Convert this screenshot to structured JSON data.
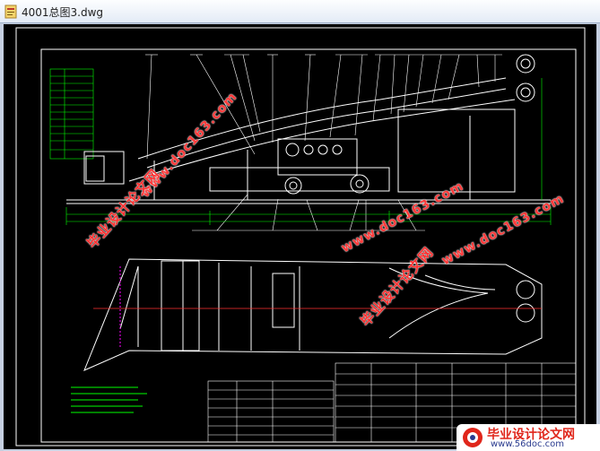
{
  "window": {
    "title": "4001总图3.dwg"
  },
  "watermarks": {
    "cn_1": "毕业设计论文网",
    "url_1": "www.doc163.com",
    "cn_2": "毕业设计论文网",
    "url_2": "www.doc163.com",
    "cn_3": "毕业设计论文网",
    "url_3": "www.doc163.com"
  },
  "site_badge": {
    "name": "毕业设计论文网",
    "url": "www.56doc.com"
  },
  "colors": {
    "canvas_bg": "#000000",
    "drawing_line": "#ffffff",
    "dim_line": "#00ff00",
    "center_line": "#ff3030",
    "hatch": "#ff00ff",
    "watermark": "#ff3030"
  }
}
